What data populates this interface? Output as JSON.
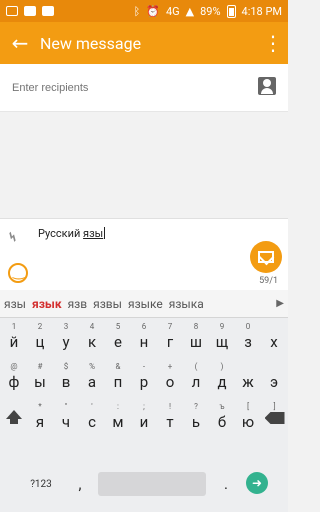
{
  "status_bar": {
    "network": "4G",
    "battery_percent": "89%",
    "time": "4:18 PM"
  },
  "appbar": {
    "title": "New message"
  },
  "recipients": {
    "placeholder": "Enter recipients"
  },
  "compose": {
    "text_prefix": "Русский ",
    "text_underlined": "язы",
    "char_counter": "59/1"
  },
  "keyboard": {
    "suggestions": [
      "язы",
      "язык",
      "язв",
      "язвы",
      "языке",
      "языка"
    ],
    "selected_suggestion_index": 1,
    "row1": [
      {
        "main": "й",
        "sub": "1"
      },
      {
        "main": "ц",
        "sub": "2"
      },
      {
        "main": "у",
        "sub": "3"
      },
      {
        "main": "к",
        "sub": "4"
      },
      {
        "main": "е",
        "sub": "5"
      },
      {
        "main": "н",
        "sub": "6"
      },
      {
        "main": "г",
        "sub": "7"
      },
      {
        "main": "ш",
        "sub": "8"
      },
      {
        "main": "щ",
        "sub": "9"
      },
      {
        "main": "з",
        "sub": "0"
      },
      {
        "main": "х",
        "sub": ""
      }
    ],
    "row2": [
      {
        "main": "ф",
        "sub": "@"
      },
      {
        "main": "ы",
        "sub": "#"
      },
      {
        "main": "в",
        "sub": "$"
      },
      {
        "main": "а",
        "sub": "%"
      },
      {
        "main": "п",
        "sub": "&"
      },
      {
        "main": "р",
        "sub": "-"
      },
      {
        "main": "о",
        "sub": "+"
      },
      {
        "main": "л",
        "sub": "("
      },
      {
        "main": "д",
        "sub": ")"
      },
      {
        "main": "ж",
        "sub": ""
      },
      {
        "main": "э",
        "sub": ""
      }
    ],
    "row3": [
      {
        "main": "я",
        "sub": "*"
      },
      {
        "main": "ч",
        "sub": "\""
      },
      {
        "main": "с",
        "sub": "'"
      },
      {
        "main": "м",
        "sub": ":"
      },
      {
        "main": "и",
        "sub": ";"
      },
      {
        "main": "т",
        "sub": "!"
      },
      {
        "main": "ь",
        "sub": "?"
      },
      {
        "main": "б",
        "sub": "ъ"
      },
      {
        "main": "ю",
        "sub": "["
      }
    ],
    "row3_ends": [
      "]"
    ],
    "symbols_key": "?123",
    "comma": ",",
    "period": "."
  },
  "colors": {
    "status_bar": "#e8890b",
    "appbar": "#f39c12",
    "accent": "#f39c12",
    "suggestion_highlight": "#d32f2f",
    "go_button": "#33b28f"
  }
}
